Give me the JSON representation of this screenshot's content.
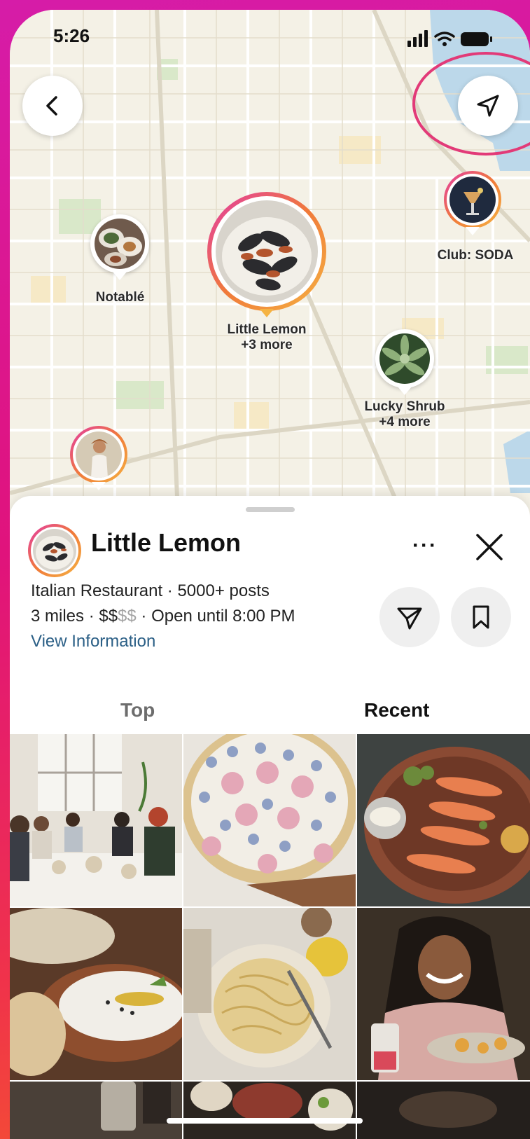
{
  "status_bar": {
    "time": "5:26"
  },
  "map": {
    "pins": [
      {
        "id": "notable",
        "label": "Notablé",
        "sublabel": ""
      },
      {
        "id": "little-lemon",
        "label": "Little Lemon",
        "sublabel": "+3 more"
      },
      {
        "id": "club-soda",
        "label": "Club: SODA",
        "sublabel": ""
      },
      {
        "id": "lucky-shrub",
        "label": "Lucky Shrub",
        "sublabel": "+4 more"
      },
      {
        "id": "person",
        "label": "",
        "sublabel": ""
      }
    ],
    "buttons": {
      "back": "back-icon",
      "location": "navigation-arrow-icon"
    },
    "highlight_color": "#e23a78"
  },
  "sheet": {
    "title": "Little Lemon",
    "more": "···",
    "info_line1": "Italian Restaurant · 5000+ posts",
    "info_line2_prefix": "3 miles · $$",
    "info_line2_dim": "$$",
    "info_line2_suffix": " · Open until 8:00 PM",
    "view_information": "View Information",
    "tabs": [
      {
        "label": "Top",
        "active": false
      },
      {
        "label": "Recent",
        "active": true
      }
    ]
  },
  "colors": {
    "accent_gradient": [
      "#e23aa7",
      "#f07a3a",
      "#f5b342"
    ],
    "link": "#2b5f86"
  }
}
